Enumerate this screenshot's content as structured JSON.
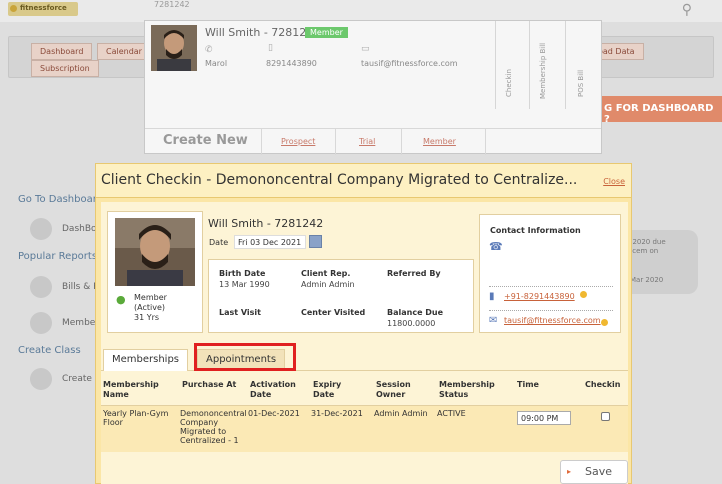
{
  "app": {
    "logo_text": "fitnessforce",
    "search_value": "7281242"
  },
  "nav": {
    "tabs": [
      "Dashboard",
      "Calendar",
      "oad Data",
      "Subscription"
    ]
  },
  "left_menu": {
    "go_to_dashboard": "Go To Dashboard",
    "dashboard_item": "DashBo",
    "popular_reports": "Popular Reports",
    "bills_item": "Bills & R",
    "member_item": "Membe",
    "create_class": "Create Class",
    "create_item": "Create C"
  },
  "banner": {
    "text": "G FOR DASHBOARD ?"
  },
  "right_card": {
    "line1": ", 2020 due",
    "line2": "ocem on",
    "line3": "Mar 2020"
  },
  "search_popup": {
    "name": "Will Smith - 7281242",
    "badge": "Member",
    "location": "Marol",
    "phone": "8291443890",
    "email": "tausif@fitnessforce.com",
    "col_checkin": "Checkin",
    "col_membership_bill": "Membership Bill",
    "col_pos_bill": "POS Bill",
    "create_new": "Create New",
    "link_prospect": "Prospect",
    "link_trial": "Trial",
    "link_member": "Member"
  },
  "modal": {
    "title": "Client Checkin - Demononcentral Company Migrated to Centralize...",
    "close": "Close",
    "client": {
      "name": "Will Smith - 7281242",
      "date_label": "Date",
      "date_value": "Fri 03 Dec 2021",
      "member_line1": "Member",
      "member_line2": "(Active)",
      "member_line3": "31 Yrs"
    },
    "info": {
      "birth_date_label": "Birth Date",
      "birth_date": "13 Mar 1990",
      "client_rep_label": "Client Rep.",
      "client_rep": "Admin Admin",
      "referred_by_label": "Referred By",
      "last_visit_label": "Last Visit",
      "center_visited_label": "Center Visited",
      "balance_due_label": "Balance Due",
      "balance_due": "11800.0000"
    },
    "contact": {
      "title": "Contact Information",
      "phone": "+91-8291443890",
      "email": "tausif@fitnessforce.com"
    },
    "tabs": {
      "memberships": "Memberships",
      "appointments": "Appointments"
    },
    "table": {
      "headers": {
        "membership_name": [
          "Membership",
          "Name"
        ],
        "purchase_at": "Purchase At",
        "activation_date": [
          "Activation",
          "Date"
        ],
        "expiry_date": [
          "Expiry",
          "Date"
        ],
        "session_owner": [
          "Session",
          "Owner"
        ],
        "membership_status": [
          "Membership",
          "Status"
        ],
        "time": "Time",
        "checkin": "Checkin"
      },
      "row": {
        "membership_name": [
          "Yearly Plan-Gym",
          "Floor"
        ],
        "purchase_at": [
          "Demononcentral",
          "Company",
          "Migrated to",
          "Centralized - 1"
        ],
        "activation_date": "01-Dec-2021",
        "expiry_date": "31-Dec-2021",
        "session_owner": "Admin Admin",
        "status": "ACTIVE",
        "time": "09:00 PM"
      }
    },
    "save_label": "Save"
  }
}
